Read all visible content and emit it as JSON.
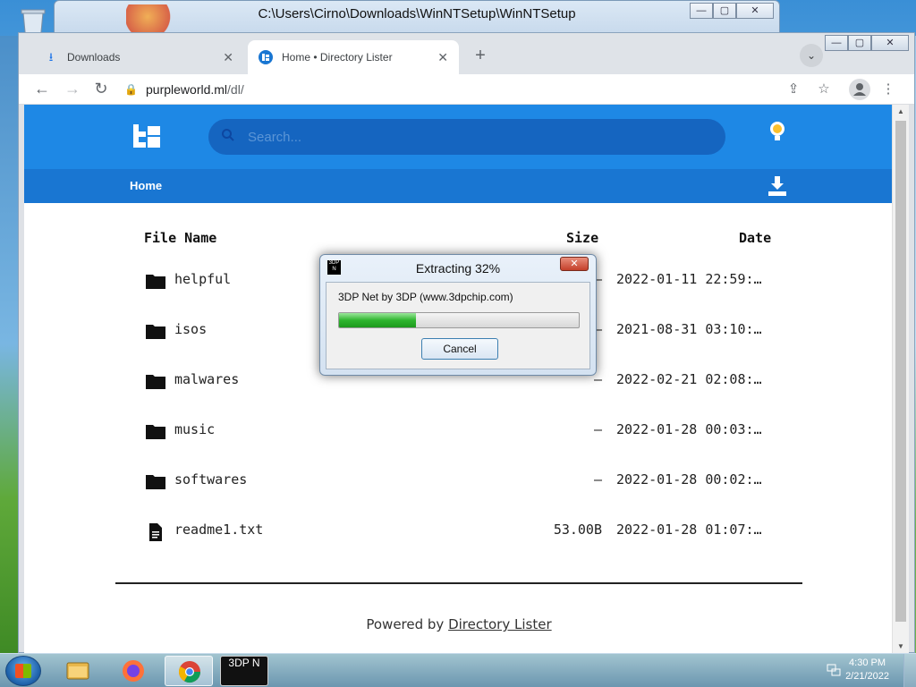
{
  "desktop": {
    "recycle_bin_icon": "recycle-bin-icon"
  },
  "bg_window": {
    "title": "C:\\Users\\Cirno\\Downloads\\WinNTSetup\\WinNTSetup",
    "minimize": "—",
    "maximize": "▢",
    "close": "✕"
  },
  "browser": {
    "tabs": [
      {
        "label": "Downloads",
        "icon": "download-icon",
        "close": "✕"
      },
      {
        "label": "Home • Directory Lister",
        "icon": "site-favicon",
        "close": "✕"
      }
    ],
    "new_tab": "+",
    "tab_search": "⌄",
    "controls": {
      "minimize": "—",
      "maximize": "▢",
      "close": "✕"
    },
    "address": {
      "lock": "🔒",
      "host": "purpleworld.ml",
      "path": "/dl/"
    },
    "nav": {
      "back": "←",
      "forward": "→",
      "reload": "↻"
    },
    "toolbar_icons": {
      "share": "⇪",
      "bookmark": "☆",
      "profile": "👤",
      "menu": "⋮"
    }
  },
  "site": {
    "search_placeholder": "Search...",
    "breadcrumb": "Home",
    "columns": {
      "name": "File Name",
      "size": "Size",
      "date": "Date"
    },
    "files": [
      {
        "name": "helpful",
        "type": "folder",
        "size": "—",
        "date": "2022-01-11 22:59:…"
      },
      {
        "name": "isos",
        "type": "folder",
        "size": "—",
        "date": "2021-08-31 03:10:…"
      },
      {
        "name": "malwares",
        "type": "folder",
        "size": "—",
        "date": "2022-02-21 02:08:…"
      },
      {
        "name": "music",
        "type": "folder",
        "size": "—",
        "date": "2022-01-28 00:03:…"
      },
      {
        "name": "softwares",
        "type": "folder",
        "size": "—",
        "date": "2022-01-28 00:02:…"
      },
      {
        "name": "readme1.txt",
        "type": "file",
        "size": "53.00B",
        "date": "2022-01-28 01:07:…"
      }
    ],
    "footer_prefix": "Powered by",
    "footer_link": "Directory Lister",
    "colors": {
      "header": "#1e88e5",
      "breadcrumb_bar": "#1976d2",
      "search": "#1565c0"
    }
  },
  "dialog": {
    "icon_text": "3DP N",
    "title": "Extracting 32%",
    "close": "✕",
    "message": "3DP Net by 3DP (www.3dpchip.com)",
    "progress": 0.32,
    "cancel_label": "Cancel"
  },
  "taskbar": {
    "time": "4:30 PM",
    "date": "2/21/2022",
    "apps": [
      "explorer-icon",
      "firefox-icon",
      "chrome-icon",
      "3dp-net-icon"
    ],
    "active_app_label": "3DP N"
  }
}
